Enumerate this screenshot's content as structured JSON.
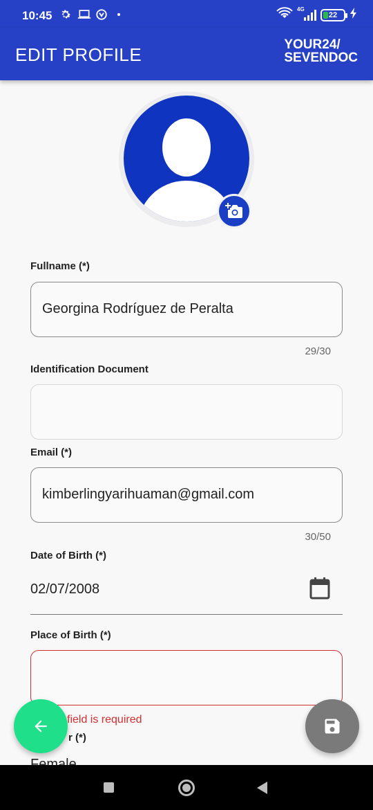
{
  "status_bar": {
    "time": "10:45",
    "network": "4G",
    "battery": "22",
    "icons": [
      "settings-icon",
      "laptop-icon",
      "vpn-icon",
      "wifi-icon",
      "signal-icon",
      "battery-icon",
      "charging-icon"
    ]
  },
  "app_bar": {
    "title": "EDIT PROFILE",
    "logo_line1": "YOUR24/",
    "logo_line2": "SEVENDOC"
  },
  "form": {
    "fullname": {
      "label": "Fullname (*)",
      "value": "Georgina Rodríguez de Peralta",
      "counter": "29/30"
    },
    "id_document": {
      "label": "Identification Document",
      "value": ""
    },
    "email": {
      "label": "Email (*)",
      "value": "kimberlingyarihuaman@gmail.com",
      "counter": "30/50"
    },
    "dob": {
      "label": "Date of Birth (*)",
      "value": "02/07/2008"
    },
    "place_of_birth": {
      "label": "Place of Birth (*)",
      "value": "",
      "error": "field is required"
    },
    "gender": {
      "label_partial": "r (*)",
      "value_partial": "Female"
    }
  },
  "colors": {
    "primary": "#2640c6",
    "avatar": "#0f35c0",
    "accent_green": "#20df8a",
    "error": "#d32f2f",
    "save_gray": "#7a7a7a"
  }
}
